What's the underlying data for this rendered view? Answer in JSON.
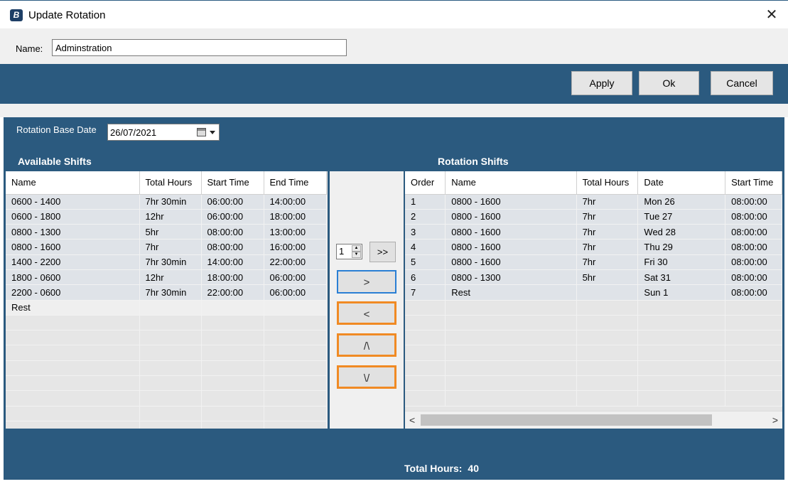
{
  "window": {
    "title": "Update Rotation",
    "close_glyph": "✕",
    "icon_glyph": "B"
  },
  "name_field": {
    "label": "Name:",
    "value": "Adminstration"
  },
  "buttons": {
    "apply": "Apply",
    "ok": "Ok",
    "cancel": "Cancel"
  },
  "rotation": {
    "base_date_label": "Rotation Base Date",
    "base_date_value": "26/07/2021"
  },
  "available": {
    "title": "Available Shifts",
    "columns": [
      "Name",
      "Total Hours",
      "Start Time",
      "End Time"
    ],
    "rows": [
      [
        "0600 - 1400",
        "7hr 30min",
        "06:00:00",
        "14:00:00"
      ],
      [
        "0600 - 1800",
        "12hr",
        "06:00:00",
        "18:00:00"
      ],
      [
        "0800 - 1300",
        "5hr",
        "08:00:00",
        "13:00:00"
      ],
      [
        "0800 - 1600",
        "7hr",
        "08:00:00",
        "16:00:00"
      ],
      [
        "1400 - 2200",
        "7hr 30min",
        "14:00:00",
        "22:00:00"
      ],
      [
        "1800 - 0600",
        "12hr",
        "18:00:00",
        "06:00:00"
      ],
      [
        "2200 - 0600",
        "7hr 30min",
        "22:00:00",
        "06:00:00"
      ],
      [
        "Rest",
        "",
        "",
        ""
      ]
    ]
  },
  "middle": {
    "spin_value": "1",
    "add_all": ">>",
    "add": ">",
    "remove": "<",
    "move_up": "/\\",
    "move_down": "\\/"
  },
  "rotation_shifts": {
    "title": "Rotation Shifts",
    "columns": [
      "Order",
      "Name",
      "Total Hours",
      "Date",
      "Start Time"
    ],
    "rows": [
      [
        "1",
        "0800 - 1600",
        "7hr",
        "Mon 26",
        "08:00:00"
      ],
      [
        "2",
        "0800 - 1600",
        "7hr",
        "Tue 27",
        "08:00:00"
      ],
      [
        "3",
        "0800 - 1600",
        "7hr",
        "Wed 28",
        "08:00:00"
      ],
      [
        "4",
        "0800 - 1600",
        "7hr",
        "Thu 29",
        "08:00:00"
      ],
      [
        "5",
        "0800 - 1600",
        "7hr",
        "Fri 30",
        "08:00:00"
      ],
      [
        "6",
        "0800 - 1300",
        "5hr",
        "Sat 31",
        "08:00:00"
      ],
      [
        "7",
        "Rest",
        "",
        "Sun 1",
        "08:00:00"
      ]
    ],
    "scroll_left": "<",
    "scroll_right": ">"
  },
  "totals": {
    "label": "Total Hours:",
    "value": "40"
  },
  "colors": {
    "panel": "#2b5a7f",
    "highlight": "#f08a24",
    "focus": "#2a7fd4"
  }
}
